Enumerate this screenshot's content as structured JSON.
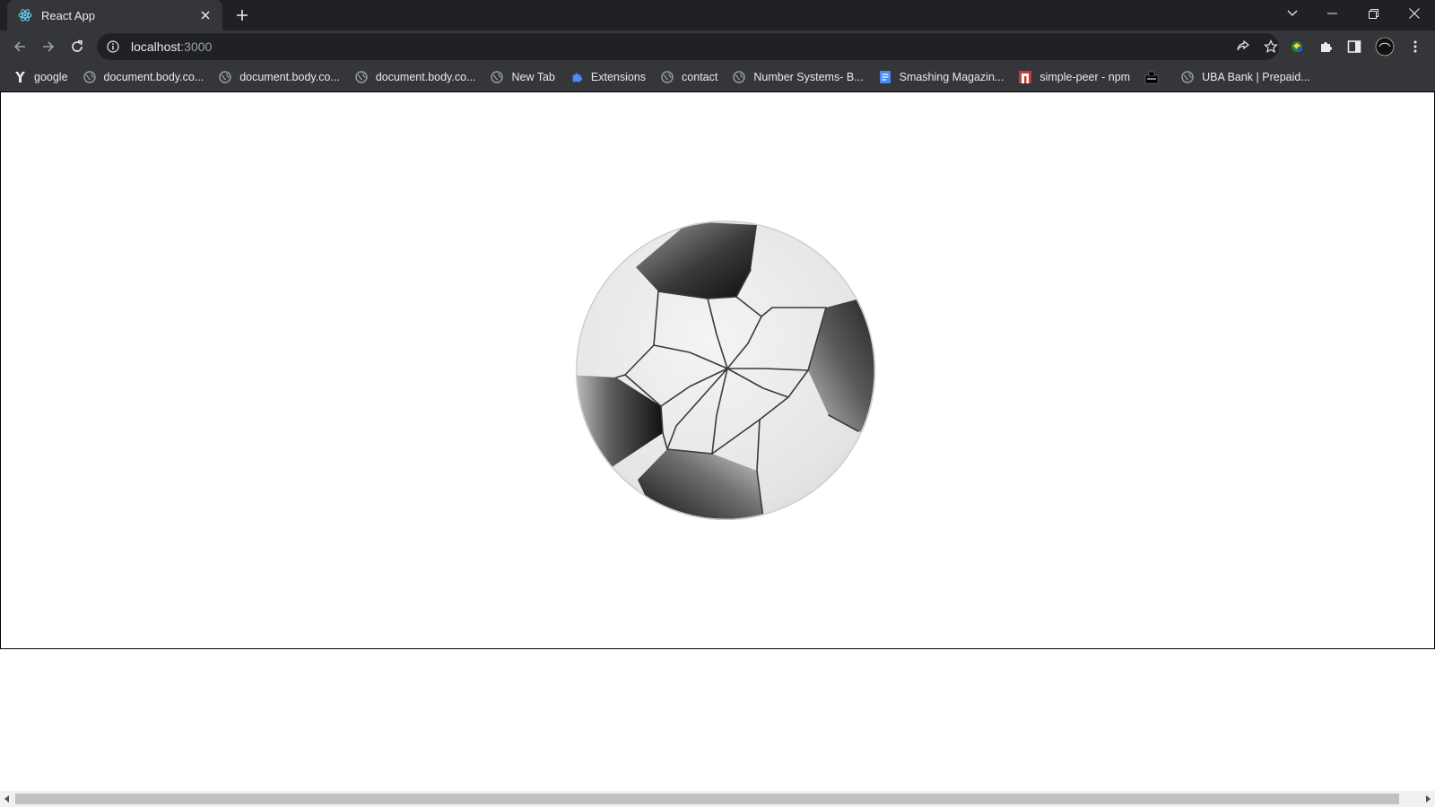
{
  "tab": {
    "title": "React App",
    "favicon": "react-icon",
    "close": "close-icon"
  },
  "window_controls": [
    "tab-search-icon",
    "minimize-icon",
    "restore-icon",
    "close-icon"
  ],
  "toolbar": {
    "back": "back-arrow-icon",
    "forward": "forward-arrow-icon",
    "reload": "reload-icon",
    "url_host": "localhost",
    "url_port": ":3000",
    "omnibox_icons": [
      "share-icon",
      "bookmark-star-icon"
    ],
    "actions": [
      "extension-color-icon",
      "puzzle-extensions-icon",
      "side-panel-icon",
      "profile-avatar",
      "menu-kebab-icon"
    ]
  },
  "bookmarks": [
    {
      "label": "google",
      "icon": "google-y-icon"
    },
    {
      "label": "document.body.co...",
      "icon": "globe-icon"
    },
    {
      "label": "document.body.co...",
      "icon": "globe-icon"
    },
    {
      "label": "document.body.co...",
      "icon": "globe-icon"
    },
    {
      "label": "New Tab",
      "icon": "globe-icon"
    },
    {
      "label": "Extensions",
      "icon": "puzzle-icon"
    },
    {
      "label": "contact",
      "icon": "globe-icon"
    },
    {
      "label": "Number Systems- B...",
      "icon": "globe-icon"
    },
    {
      "label": "Smashing Magazin...",
      "icon": "doc-icon"
    },
    {
      "label": "simple-peer - npm",
      "icon": "npm-icon"
    },
    {
      "label": "",
      "icon": "folder-dark-icon"
    },
    {
      "label": "UBA Bank | Prepaid...",
      "icon": "globe-icon"
    }
  ],
  "colors": {
    "chrome_dark": "#202124",
    "chrome_toolbar": "#35363a",
    "text": "#e8eaed",
    "muted": "#9aa0a6"
  },
  "canvas": {
    "content": "soccer-ball-3d-render"
  }
}
